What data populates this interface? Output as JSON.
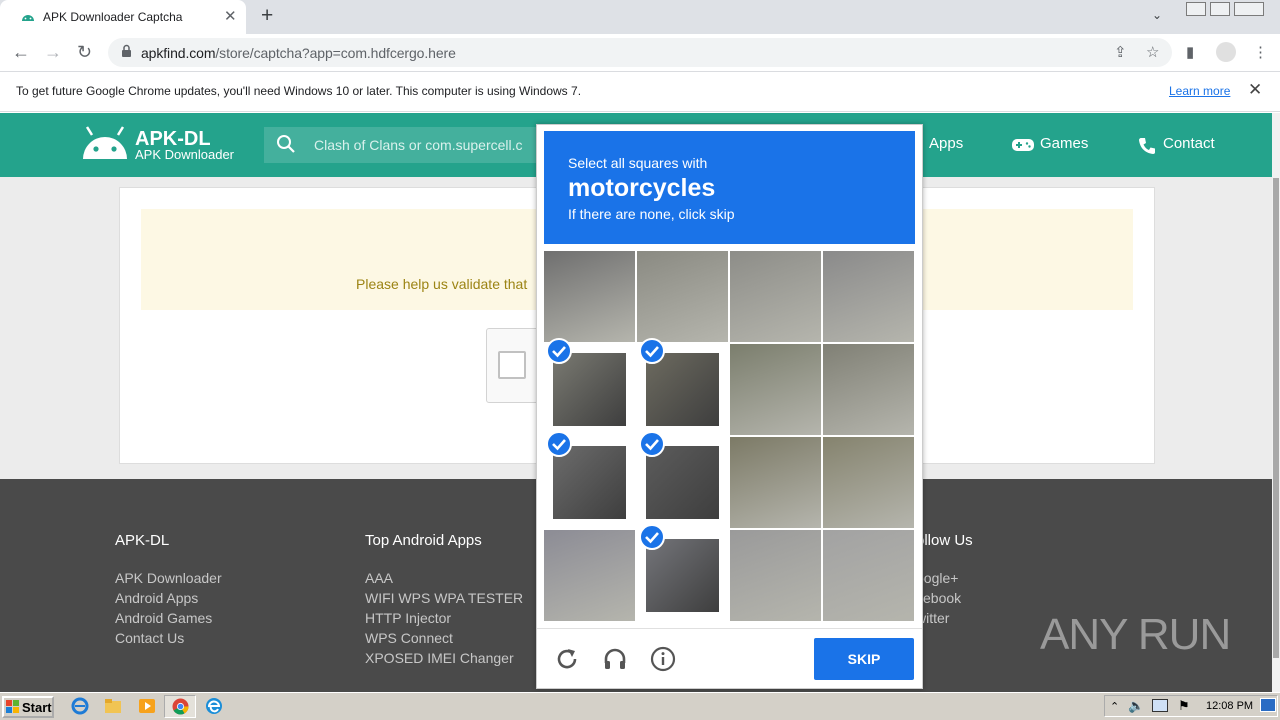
{
  "browser": {
    "tab_title": "APK Downloader Captcha",
    "url_host": "apkfind.com",
    "url_path": "/store/captcha?app=com.hdfcergo.here",
    "accent": "#1a73e8"
  },
  "infobar": {
    "message": "To get future Google Chrome updates, you'll need Windows 10 or later. This computer is using Windows 7.",
    "link": "Learn more"
  },
  "site": {
    "brand_color": "#24a38c",
    "logo_title": "APK-DL",
    "logo_subtitle": "APK Downloader",
    "search_placeholder": "Clash of Clans or com.supercell.c",
    "nav": {
      "apps": "Apps",
      "games": "Games",
      "contact": "Contact"
    },
    "notice": "Please help us validate that"
  },
  "footer": {
    "col1": {
      "heading": "APK-DL",
      "links": [
        "APK Downloader",
        "Android Apps",
        "Android Games",
        "Contact Us"
      ]
    },
    "col2": {
      "heading": "Top Android Apps",
      "links": [
        "AAA",
        "WIFI WPS WPA TESTER",
        "HTTP Injector",
        "WPS Connect",
        "XPOSED IMEI Changer"
      ]
    },
    "col4": {
      "heading": "ollow Us",
      "links": [
        "oogle+",
        "cebook",
        "witter"
      ]
    },
    "watermark": "ANY RUN"
  },
  "captcha": {
    "line1": "Select all squares with",
    "target": "motorcycles",
    "line3": "If there are none, click skip",
    "skip_label": "SKIP",
    "tiles": [
      {
        "selected": false
      },
      {
        "selected": false
      },
      {
        "selected": false
      },
      {
        "selected": false
      },
      {
        "selected": true
      },
      {
        "selected": true
      },
      {
        "selected": false
      },
      {
        "selected": false
      },
      {
        "selected": true
      },
      {
        "selected": true
      },
      {
        "selected": false
      },
      {
        "selected": false
      },
      {
        "selected": false
      },
      {
        "selected": true
      },
      {
        "selected": false
      },
      {
        "selected": false
      }
    ]
  },
  "taskbar": {
    "start": "Start",
    "clock": "12:08 PM"
  }
}
